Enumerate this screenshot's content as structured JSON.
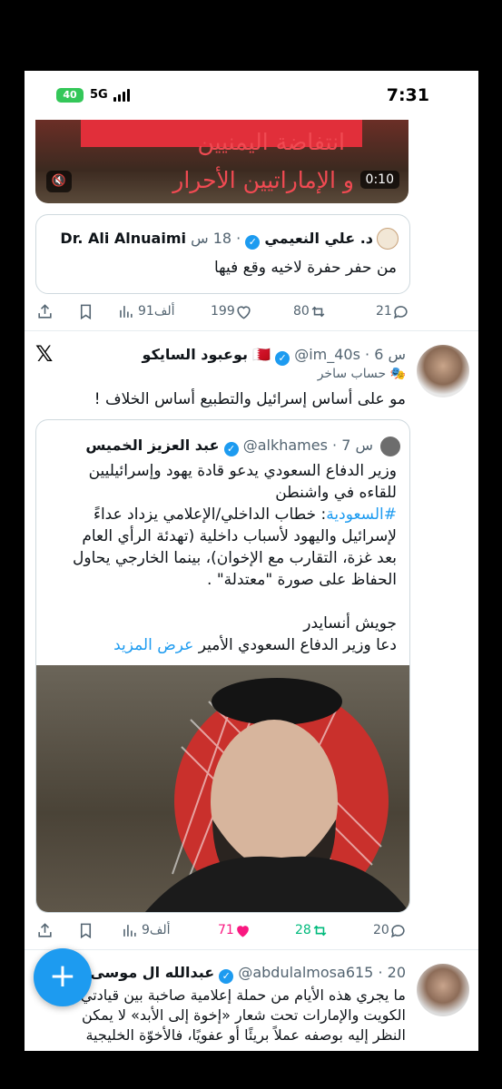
{
  "status_bar": {
    "time": "7:31",
    "battery": "40",
    "network": "5G"
  },
  "video": {
    "line1": "انتفاضة اليمنيين",
    "line2": "و الإماراتيين الأحرار",
    "duration": "0:10"
  },
  "embedded_tweet": {
    "author_en": "Dr. Ali Alnuaimi",
    "author_ar": "د. علي النعيمي",
    "time": "18 س",
    "text": "من حفر حفرة لاخيه وقع فيها"
  },
  "tweet1_actions": {
    "replies": "21",
    "retweets": "80",
    "likes": "199",
    "views": "91ألف"
  },
  "tweet2": {
    "author": "بوعبود السايكو",
    "flag": "🇧🇭",
    "handle": "@im_40s",
    "time": "6 س",
    "label": "حساب ساخر",
    "text": "مو على أساس إسرائيل والتطبيع أساس الخلاف !",
    "quote": {
      "author": "عبد العزيز الخميس",
      "handle": "@alkhames",
      "time": "7 س",
      "para1": "وزير الدفاع السعودي يدعو قادة يهود وإسرائيليين\nللقاءه في واشنطن",
      "hashtag": "#السعودية",
      "para2": ": خطاب الداخلي/الإعلامي يزداد عداءً\nلإسرائيل واليهود لأسباب داخلية (تهدئة الرأي العام\nبعد غزة، التقارب مع الإخوان)، بينما الخارجي يحاول\nالحفاظ على صورة \"معتدلة\" .",
      "para3": "جويش أنسايدر",
      "para4": "دعا وزير الدفاع السعودي الأمير ",
      "show_more": "عرض المزيد"
    },
    "actions": {
      "replies": "20",
      "retweets": "28",
      "likes": "71",
      "views": "9ألف"
    }
  },
  "tweet3": {
    "author": "عبدالله ال موسى",
    "handle": "@abdulalmosa615",
    "time": "20",
    "text": "ما يجري هذه الأيام من حملة إعلامية صاخبة بين قيادتي\nالكويت والإمارات تحت شعار «إخوة إلى الأبد» لا يمكن\nالنظر إليه بوصفه عملاً بريئًا أو عفويًا، فالأخوّة الخليجية"
  },
  "colors": {
    "accent": "#1d9bf0",
    "like": "#f91880",
    "retweet": "#00ba7c"
  }
}
